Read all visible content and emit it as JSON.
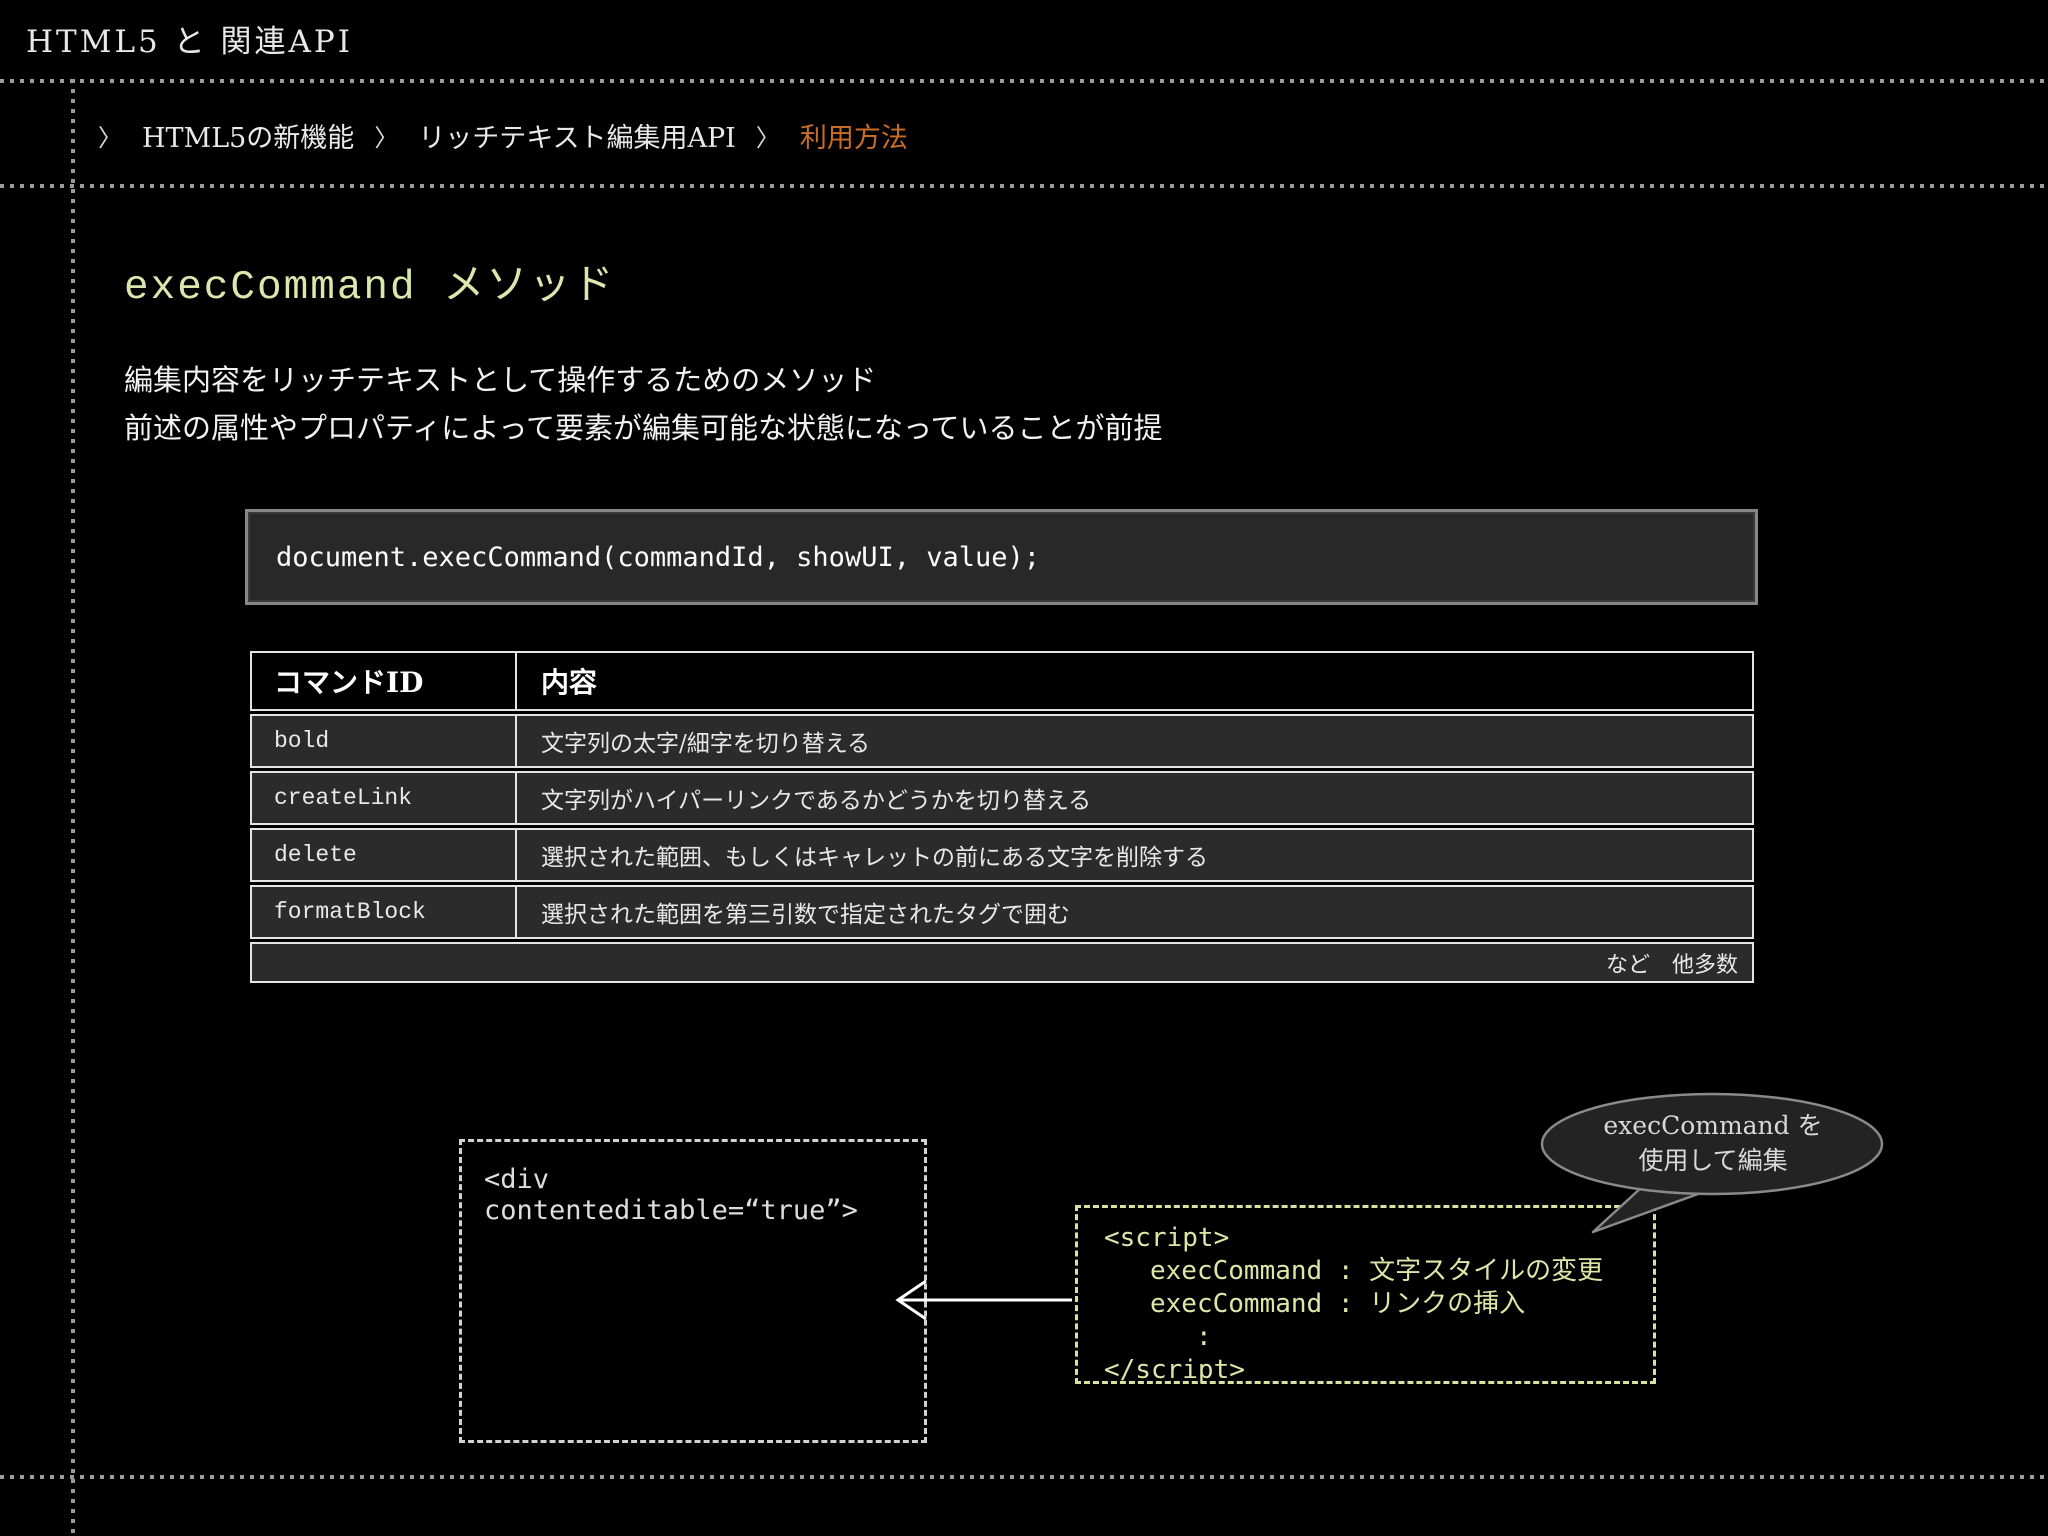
{
  "page": {
    "background": "#000000",
    "rule_color": "#9b9b9b"
  },
  "header": {
    "title": "HTML5 と 関連API"
  },
  "breadcrumb": {
    "separator": "〉",
    "items": [
      {
        "label": "HTML5の新機能"
      },
      {
        "label": "リッチテキスト編集用API"
      },
      {
        "label": "利用方法"
      }
    ],
    "active_color": "#c76d28"
  },
  "main": {
    "title": "execCommand メソッド",
    "title_color": "#dce7ad",
    "description_line1": "編集内容をリッチテキストとして操作するためのメソッド",
    "description_line2": "前述の属性やプロパティによって要素が編集可能な状態になっていることが前提",
    "code_snippet": "document.execCommand(commandId, showUI, value);"
  },
  "command_table": {
    "headers": {
      "id": "コマンドID",
      "description": "内容"
    },
    "rows": [
      {
        "id": "bold",
        "description": "文字列の太字/細字を切り替える"
      },
      {
        "id": "createLink",
        "description": "文字列がハイパーリンクであるかどうかを切り替える"
      },
      {
        "id": "delete",
        "description": "選択された範囲、もしくはキャレットの前にある文字を削除する"
      },
      {
        "id": "formatBlock",
        "description": "選択された範囲を第三引数で指定されたタグで囲む"
      }
    ],
    "footer_note": "など　他多数"
  },
  "diagram": {
    "editable_box_label": "<div contenteditable=“true”>",
    "script_box": {
      "color": "#dde6a6",
      "line1": "<script>",
      "line2": "execCommand : 文字スタイルの変更",
      "line3": "execCommand : リンクの挿入",
      "line4": ":",
      "line5": "</script>"
    },
    "bubble": {
      "line1": "execCommand を",
      "line2": "使用して編集"
    }
  }
}
